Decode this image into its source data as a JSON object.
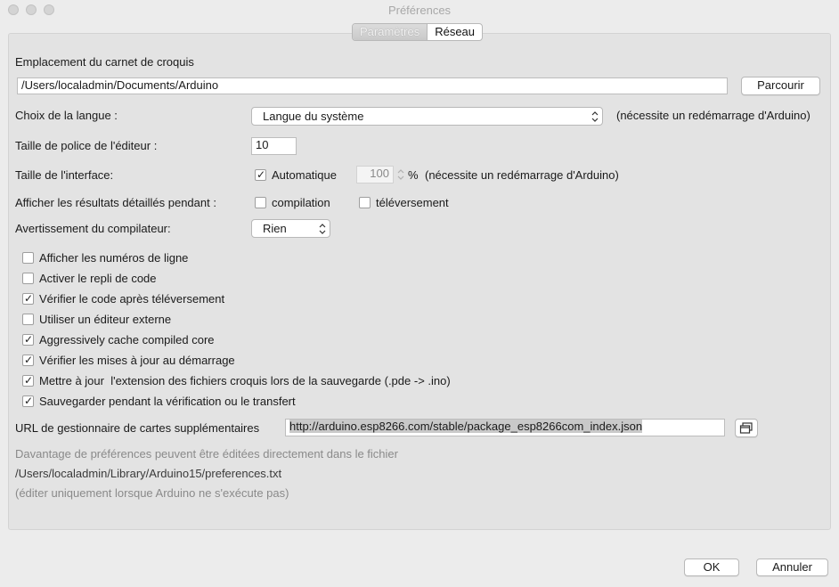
{
  "window": {
    "title": "Préférences"
  },
  "tabs": [
    {
      "label": "Paramètres",
      "active": true
    },
    {
      "label": "Réseau",
      "active": false
    }
  ],
  "sketchbook": {
    "label": "Emplacement du carnet de croquis",
    "value": "/Users/localadmin/Documents/Arduino",
    "browse_label": "Parcourir"
  },
  "language": {
    "label": "Choix de la langue :",
    "selected": "Langue du système",
    "note": "(nécessite un redémarrage d'Arduino)"
  },
  "font_size": {
    "label": "Taille de police de l'éditeur :",
    "value": "10"
  },
  "interface_scale": {
    "label": "Taille de l'interface:",
    "auto_label": "Automatique",
    "auto_checked": true,
    "value": "100",
    "unit": "%",
    "note": "(nécessite un redémarrage d'Arduino)"
  },
  "verbose": {
    "label": "Afficher les résultats détaillés pendant :",
    "compile_label": "compilation",
    "compile_checked": false,
    "upload_label": "téléversement",
    "upload_checked": false
  },
  "warnings": {
    "label": "Avertissement du compilateur:",
    "selected": "Rien"
  },
  "options": [
    {
      "label": "Afficher les numéros de ligne",
      "checked": false
    },
    {
      "label": "Activer le repli de code",
      "checked": false
    },
    {
      "label": "Vérifier le code après téléversement",
      "checked": true
    },
    {
      "label": "Utiliser un éditeur externe",
      "checked": false
    },
    {
      "label": "Aggressively cache compiled core",
      "checked": true
    },
    {
      "label": "Vérifier les mises à jour au démarrage",
      "checked": true
    },
    {
      "label": "Mettre à jour  l'extension des fichiers croquis lors de la sauvegarde (.pde -> .ino)",
      "checked": true
    },
    {
      "label": "Sauvegarder pendant la vérification ou le transfert",
      "checked": true
    }
  ],
  "boards_url": {
    "label": "URL de gestionnaire de cartes supplémentaires",
    "value": "http://arduino.esp8266.com/stable/package_esp8266com_index.json",
    "button_icon": "window-icon"
  },
  "footer_info": {
    "line1": "Davantage de préférences peuvent être éditées directement dans le fichier",
    "path": "/Users/localadmin/Library/Arduino15/preferences.txt",
    "line3": "(éditer uniquement lorsque Arduino ne s'exécute pas)"
  },
  "buttons": {
    "ok": "OK",
    "cancel": "Annuler"
  },
  "check_mark": "✓"
}
